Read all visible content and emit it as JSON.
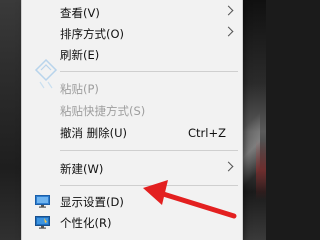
{
  "context_menu": {
    "items": [
      {
        "label": "查看(V)",
        "has_submenu": true,
        "disabled": false
      },
      {
        "label": "排序方式(O)",
        "has_submenu": true,
        "disabled": false
      },
      {
        "label": "刷新(E)",
        "has_submenu": false,
        "disabled": false
      },
      {
        "label": "粘贴(P)",
        "has_submenu": false,
        "disabled": true
      },
      {
        "label": "粘贴快捷方式(S)",
        "has_submenu": false,
        "disabled": true
      },
      {
        "label": "撤消 删除(U)",
        "shortcut": "Ctrl+Z",
        "has_submenu": false,
        "disabled": false
      },
      {
        "label": "新建(W)",
        "has_submenu": true,
        "disabled": false
      },
      {
        "label": "显示设置(D)",
        "icon": "display-settings-icon",
        "has_submenu": false,
        "disabled": false
      },
      {
        "label": "个性化(R)",
        "icon": "personalize-icon",
        "has_submenu": false,
        "disabled": false
      }
    ]
  },
  "annotation": {
    "arrow_color": "#e32020",
    "points_to": "显示设置(D)"
  },
  "colors": {
    "menu_bg": "#f2f2f2",
    "disabled_text": "#9e9e9e",
    "separator": "#cfcfcf"
  }
}
